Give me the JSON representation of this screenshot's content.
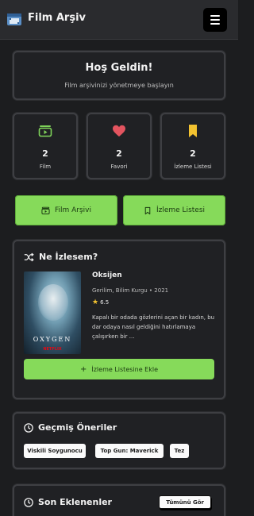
{
  "app": {
    "title": "Film Arşiv"
  },
  "welcome": {
    "title": "Hoş Geldin!",
    "subtitle": "Film arşivinizi yönetmeye başlayın"
  },
  "stats": [
    {
      "value": "2",
      "label": "Film",
      "icon": "film-play-icon",
      "color": "#7fd45a"
    },
    {
      "value": "2",
      "label": "Favori",
      "icon": "heart-icon",
      "color": "#e3545f"
    },
    {
      "value": "2",
      "label": "İzleme Listesi",
      "icon": "bookmark-icon",
      "color": "#f2c230"
    }
  ],
  "actions": {
    "archive": "Film Arşivi",
    "watchlist": "İzleme Listesi"
  },
  "suggestion": {
    "heading": "Ne İzlesem?",
    "movie": {
      "title": "Oksijen",
      "meta": "Gerilim, Bilim Kurgu • 2021",
      "rating": "6.5",
      "description": "Kapalı bir odada gözlerini açan bir kadın, bu dar odaya nasıl geldiğini hatırlamaya çalışırken bir ...",
      "poster_text": "OXYGEN",
      "poster_brand": "NETFLIX"
    },
    "add_button": "İzleme Listesine Ekle"
  },
  "history": {
    "heading": "Geçmiş Öneriler",
    "chips": [
      "Viskili Soygunocu",
      "Top Gun: Maverick",
      "Tez"
    ]
  },
  "recent": {
    "heading": "Son Eklenenler",
    "see_all": "Tümünü Gör"
  },
  "colors": {
    "accent": "#86da5a",
    "background": "#1c1d1f",
    "card": "#202124"
  }
}
